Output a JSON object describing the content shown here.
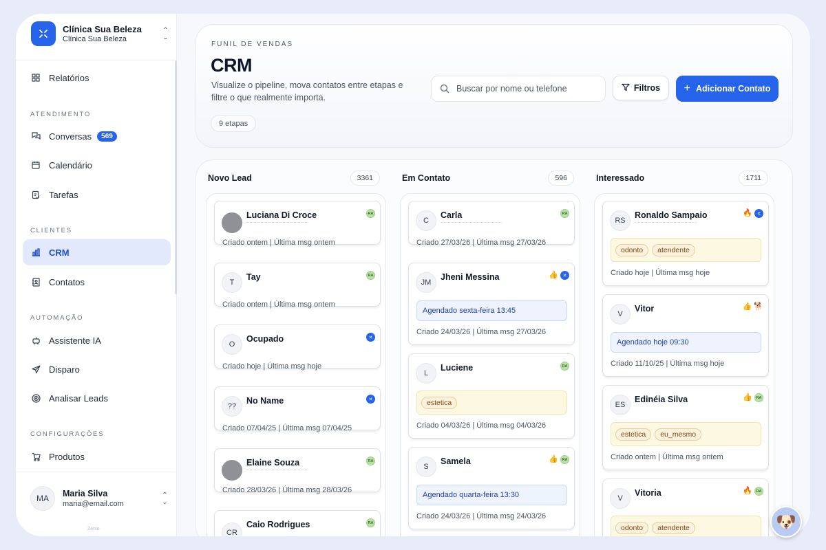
{
  "sidebar": {
    "org_name": "Clínica Sua Beleza",
    "org_sub": "Clínica Sua Beleza",
    "reports": "Relatórios",
    "sections": {
      "attendance": "ATENDIMENTO",
      "clients": "CLIENTES",
      "automation": "AUTOMAÇÃO",
      "settings": "CONFIGURAÇÕES"
    },
    "items": {
      "conversations": "Conversas",
      "conversations_badge": "569",
      "calendar": "Calendário",
      "tasks": "Tarefas",
      "crm": "CRM",
      "contacts": "Contatos",
      "assistant": "Assistente IA",
      "dispatch": "Disparo",
      "analyze": "Analisar Leads",
      "products": "Produtos"
    },
    "user": {
      "initials": "MA",
      "name": "Maria Silva",
      "email": "maria@email.com"
    },
    "brand": "Zenio"
  },
  "header": {
    "eyebrow": "FUNIL DE VENDAS",
    "title": "CRM",
    "description": "Visualize o pipeline, mova contatos entre etapas e filtre o que realmente importa.",
    "stages": "9 etapas",
    "search_placeholder": "Buscar por nome ou telefone",
    "filters": "Filtros",
    "add_contact": "Adicionar Contato"
  },
  "columns": [
    {
      "title": "Novo Lead",
      "count": "3361",
      "cards": [
        {
          "name": "Luciana Di Croce",
          "meta": "Criado ontem | Última msg ontem"
        },
        {
          "initials": "T",
          "name": "Tay",
          "meta": "Criado ontem | Última msg ontem"
        },
        {
          "initials": "O",
          "name": "Ocupado",
          "meta": "Criado hoje | Última msg hoje"
        },
        {
          "initials": "??",
          "name": "No Name",
          "meta": "Criado 07/04/25 | Última msg 07/04/25"
        },
        {
          "name": "Elaine Souza",
          "meta": "Criado 28/03/26 | Última msg 28/03/26"
        },
        {
          "initials": "CR",
          "name": "Caio Rodrigues",
          "meta": ""
        }
      ]
    },
    {
      "title": "Em Contato",
      "count": "596",
      "cards": [
        {
          "initials": "C",
          "name": "Carla",
          "meta": "Criado 27/03/26 | Última msg 27/03/26"
        },
        {
          "initials": "JM",
          "name": "Jheni Messina",
          "schedule": "Agendado sexta-feira 13:45",
          "meta": "Criado 24/03/26 | Última msg 27/03/26"
        },
        {
          "initials": "L",
          "name": "Luciene",
          "tags": [
            "estetica"
          ],
          "meta": "Criado 04/03/26 | Última msg 04/03/26"
        },
        {
          "initials": "S",
          "name": "Samela",
          "schedule": "Agendado quarta-feira 13:30",
          "meta": "Criado 24/03/26 | Última msg 24/03/26"
        }
      ]
    },
    {
      "title": "Interessado",
      "count": "1711",
      "cards": [
        {
          "initials": "RS",
          "name": "Ronaldo Sampaio",
          "tags": [
            "odonto",
            "atendente"
          ],
          "meta": "Criado hoje | Última msg hoje"
        },
        {
          "initials": "V",
          "name": "Vitor",
          "schedule": "Agendado hoje 09:30",
          "meta": "Criado 11/10/25 | Última msg hoje"
        },
        {
          "initials": "ES",
          "name": "Edinéia Silva",
          "tags": [
            "estetica",
            "eu_mesmo"
          ],
          "meta": "Criado ontem | Última msg ontem"
        },
        {
          "initials": "V",
          "name": "Vitoria",
          "tags": [
            "odonto",
            "atendente"
          ],
          "meta": ""
        }
      ]
    }
  ],
  "badges": {
    "ra": "RA"
  },
  "colors": {
    "primary": "#2563eb",
    "active_bg": "#e3e9fc",
    "tag_bg": "#fdf8e1",
    "schedule_bg": "#eef3fe"
  }
}
